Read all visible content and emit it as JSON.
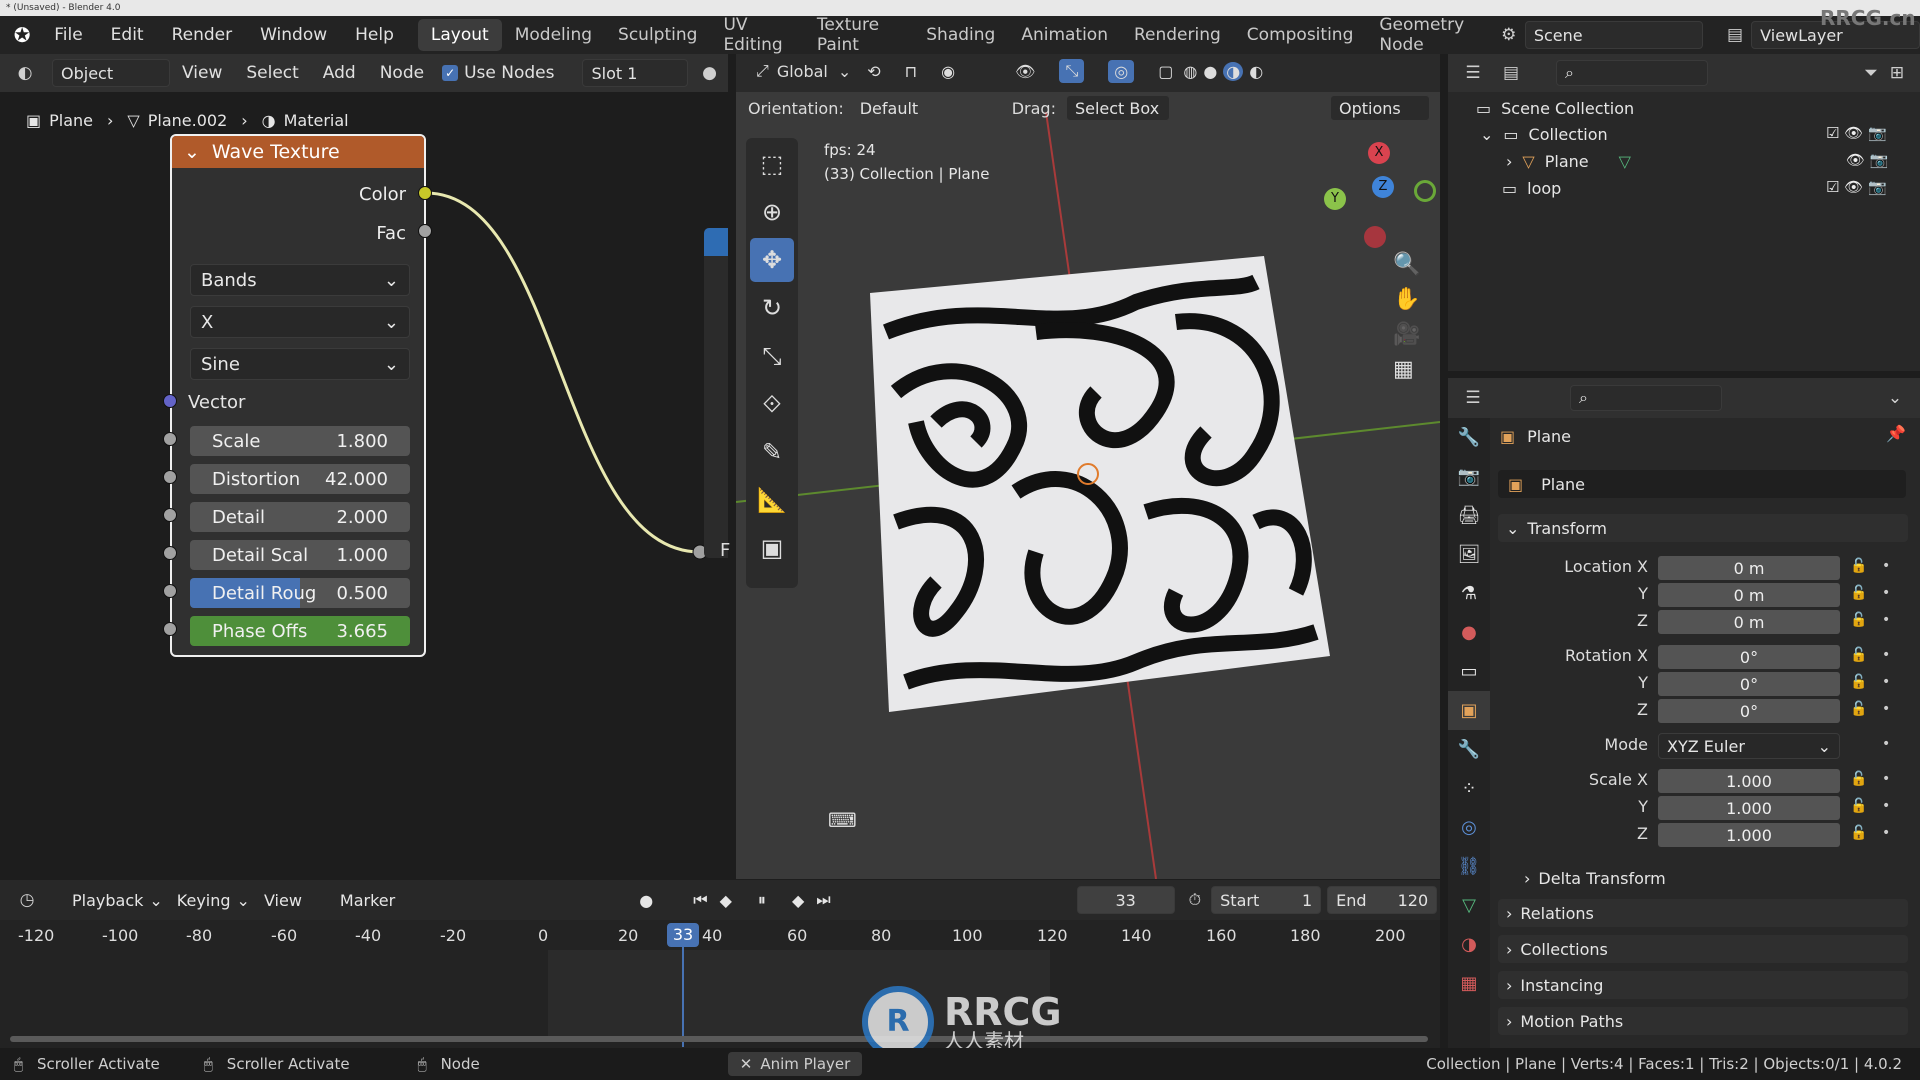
{
  "window": {
    "title": "* (Unsaved) - Blender 4.0"
  },
  "menu": [
    "File",
    "Edit",
    "Render",
    "Window",
    "Help"
  ],
  "workspaces": [
    "Layout",
    "Modeling",
    "Sculpting",
    "UV Editing",
    "Texture Paint",
    "Shading",
    "Animation",
    "Rendering",
    "Compositing",
    "Geometry Node"
  ],
  "active_workspace": "Layout",
  "scene": "Scene",
  "view_layer": "ViewLayer",
  "node_header": {
    "mode": "Object",
    "view": "View",
    "select": "Select",
    "add": "Add",
    "node": "Node",
    "use_nodes": "Use Nodes",
    "slot": "Slot 1"
  },
  "breadcrumb": [
    "Plane",
    "Plane.002",
    "Material"
  ],
  "node": {
    "title": "Wave Texture",
    "outputs": [
      "Color",
      "Fac"
    ],
    "dropdowns": [
      "Bands",
      "X",
      "Sine"
    ],
    "vector_label": "Vector",
    "fields": [
      {
        "label": "Scale",
        "value": "1.800"
      },
      {
        "label": "Distortion",
        "value": "42.000"
      },
      {
        "label": "Detail",
        "value": "2.000"
      },
      {
        "label": "Detail Scal",
        "value": "1.000"
      },
      {
        "label": "Detail Roug",
        "value": "0.500"
      },
      {
        "label": "Phase Offs",
        "value": "3.665"
      }
    ],
    "link_target": "F"
  },
  "viewport": {
    "orientation_label": "Orientation:",
    "orientation": "Default",
    "transform": "Global",
    "drag_label": "Drag:",
    "drag": "Select Box",
    "options": "Options",
    "fps": "fps: 24",
    "info": "(33) Collection | Plane",
    "gizmo": {
      "x": "X",
      "y": "Y",
      "z": "Z"
    }
  },
  "outliner": {
    "items": [
      {
        "label": "Scene Collection"
      },
      {
        "label": "Collection"
      },
      {
        "label": "Plane"
      },
      {
        "label": "loop"
      }
    ]
  },
  "properties": {
    "object_name": "Plane",
    "data_name": "Plane",
    "transform_title": "Transform",
    "location": {
      "label": "Location X",
      "x": "0 m",
      "y": "0 m",
      "z": "0 m"
    },
    "rotation": {
      "label": "Rotation X",
      "x": "0°",
      "y": "0°",
      "z": "0°"
    },
    "mode_label": "Mode",
    "mode": "XYZ Euler",
    "scale": {
      "label": "Scale X",
      "x": "1.000",
      "y": "1.000",
      "z": "1.000"
    },
    "axis_y": "Y",
    "axis_z": "Z",
    "sections": [
      "Delta Transform",
      "Relations",
      "Collections",
      "Instancing",
      "Motion Paths"
    ]
  },
  "timeline": {
    "menus": [
      "Playback",
      "Keying",
      "View",
      "Marker"
    ],
    "current_frame": "33",
    "start_label": "Start",
    "start": "1",
    "end_label": "End",
    "end": "120",
    "ruler": [
      "-120",
      "-100",
      "-80",
      "-60",
      "-40",
      "-20",
      "0",
      "20",
      "40",
      "60",
      "80",
      "100",
      "120",
      "140",
      "160",
      "180",
      "200"
    ],
    "playhead": "33"
  },
  "status": {
    "left": [
      "Scroller Activate",
      "Scroller Activate",
      "Node"
    ],
    "anim_player": "Anim Player",
    "right": "Collection | Plane | Verts:4 | Faces:1 | Tris:2 | Objects:0/1 | 4.0.2"
  },
  "watermark": "RRCG",
  "watermark_sub": "人人素材",
  "watermark_corner": "RRCG.cn",
  "colors": {
    "node_header": "#b05a2a",
    "active_blue": "#4772b3",
    "phase_green": "#4e8f3a",
    "color_socket": "#c7c729",
    "vector_socket": "#6363c7"
  }
}
